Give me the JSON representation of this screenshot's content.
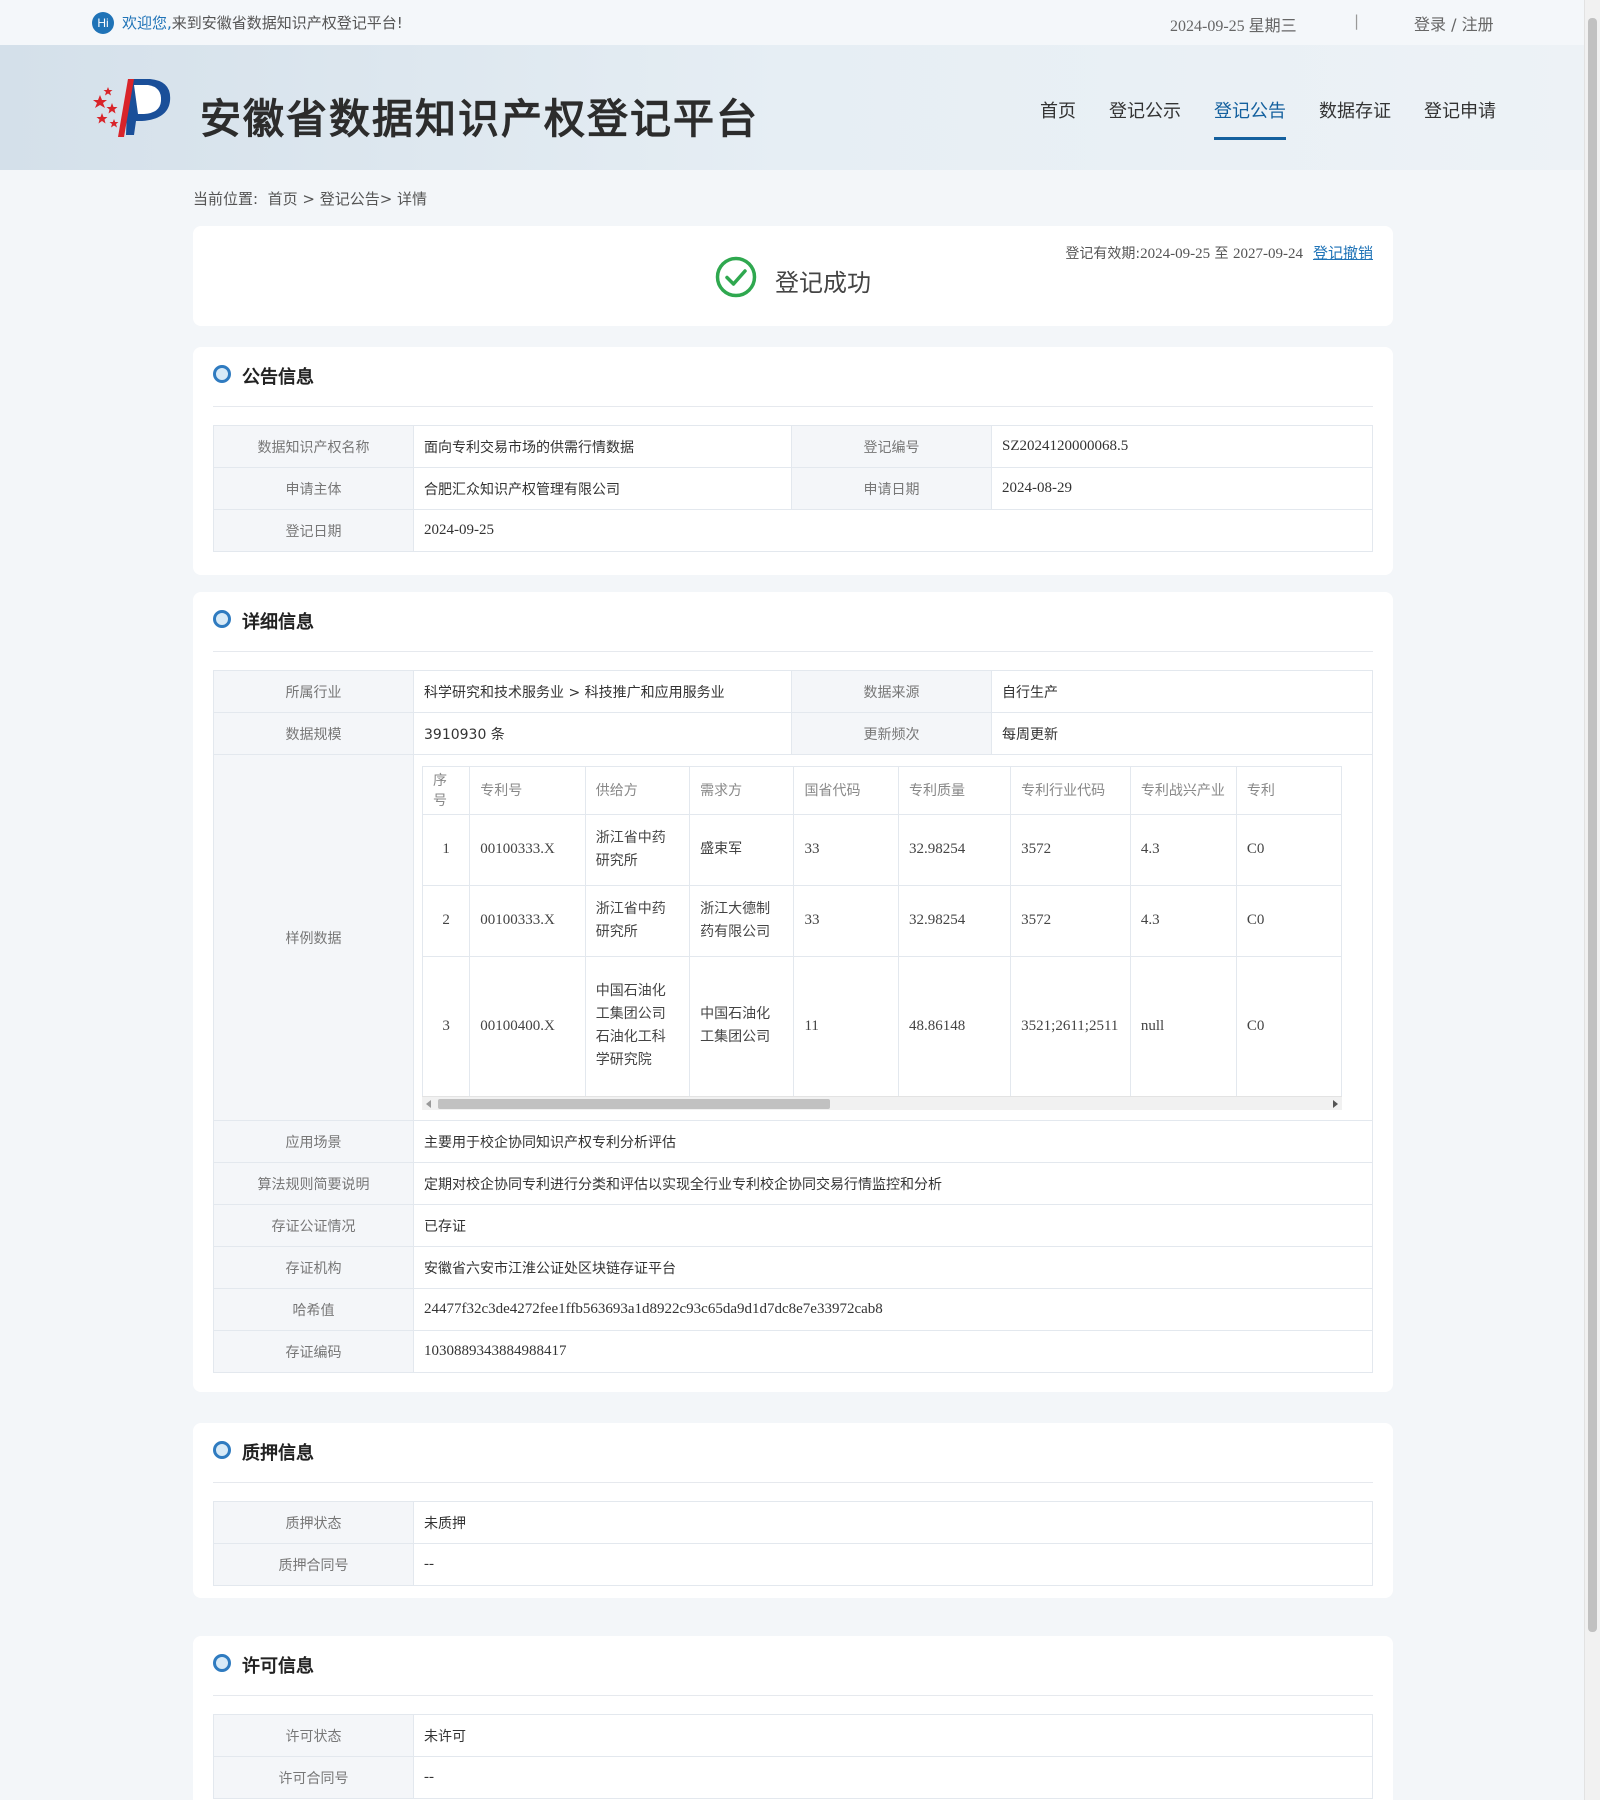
{
  "topbar": {
    "hi": "Hi",
    "welcome_highlight": "欢迎您,",
    "welcome_text": "来到安徽省数据知识产权登记平台!",
    "date": "2024-09-25 星期三",
    "separator": "|",
    "login": "登录",
    "auth_sep": " / ",
    "register": "注册"
  },
  "header": {
    "site_title": "安徽省数据知识产权登记平台",
    "nav": [
      "首页",
      "登记公示",
      "登记公告",
      "数据存证",
      "登记申请"
    ],
    "active_nav": "登记公告"
  },
  "breadcrumb": "当前位置:  首页 > 登记公告> 详情",
  "status": {
    "text": "登记成功",
    "validity_label": "登记有效期:",
    "validity_start": "2024-09-25",
    "validity_to": " 至 ",
    "validity_end": "2027-09-24",
    "revoke": "登记撤销"
  },
  "notice": {
    "title": "公告信息",
    "name_label": "数据知识产权名称",
    "name_value": "面向专利交易市场的供需行情数据",
    "reg_no_label": "登记编号",
    "reg_no_value": "SZ2024120000068.5",
    "applicant_label": "申请主体",
    "applicant_value": "合肥汇众知识产权管理有限公司",
    "apply_date_label": "申请日期",
    "apply_date_value": "2024-08-29",
    "reg_date_label": "登记日期",
    "reg_date_value": "2024-09-25"
  },
  "detail": {
    "title": "详细信息",
    "industry_label": "所属行业",
    "industry_value": "科学研究和技术服务业 > 科技推广和应用服务业",
    "source_label": "数据来源",
    "source_value": "自行生产",
    "scale_label": "数据规模",
    "scale_value": "3910930 条",
    "freq_label": "更新频次",
    "freq_value": "每周更新",
    "sample_label": "样例数据",
    "sample_headers": [
      "序号",
      "专利号",
      "供给方",
      "需求方",
      "国省代码",
      "专利质量",
      "专利行业代码",
      "专利战兴产业",
      "专利"
    ],
    "sample_rows": [
      [
        "1",
        "00100333.X",
        "浙江省中药研究所",
        "盛束军",
        "33",
        "32.98254",
        "3572",
        "4.3",
        "C0"
      ],
      [
        "2",
        "00100333.X",
        "浙江省中药研究所",
        "浙江大德制药有限公司",
        "33",
        "32.98254",
        "3572",
        "4.3",
        "C0"
      ],
      [
        "3",
        "00100400.X",
        "中国石油化工集团公司石油化工科学研究院",
        "中国石油化工集团公司",
        "11",
        "48.86148",
        "3521;2611;2511",
        "null",
        "C0"
      ]
    ],
    "scenario_label": "应用场景",
    "scenario_value": "主要用于校企协同知识产权专利分析评估",
    "algo_label": "算法规则简要说明",
    "algo_value": "定期对校企协同专利进行分类和评估以实现全行业专利校企协同交易行情监控和分析",
    "notary_label": "存证公证情况",
    "notary_value": "已存证",
    "org_label": "存证机构",
    "org_value": "安徽省六安市江淮公证处区块链存证平台",
    "hash_label": "哈希值",
    "hash_value": "24477f32c3de4272fee1ffb563693a1d8922c93c65da9d1d7dc8e7e33972cab8",
    "code_label": "存证编码",
    "code_value": "1030889343884988417"
  },
  "pledge": {
    "title": "质押信息",
    "status_label": "质押状态",
    "status_value": "未质押",
    "contract_label": "质押合同号",
    "contract_value": "--"
  },
  "license": {
    "title": "许可信息",
    "status_label": "许可状态",
    "status_value": "未许可",
    "contract_label": "许可合同号",
    "contract_value": "--"
  },
  "colors": {
    "accent": "#14609e",
    "success": "#2fa84f",
    "link": "#1f73b7"
  }
}
